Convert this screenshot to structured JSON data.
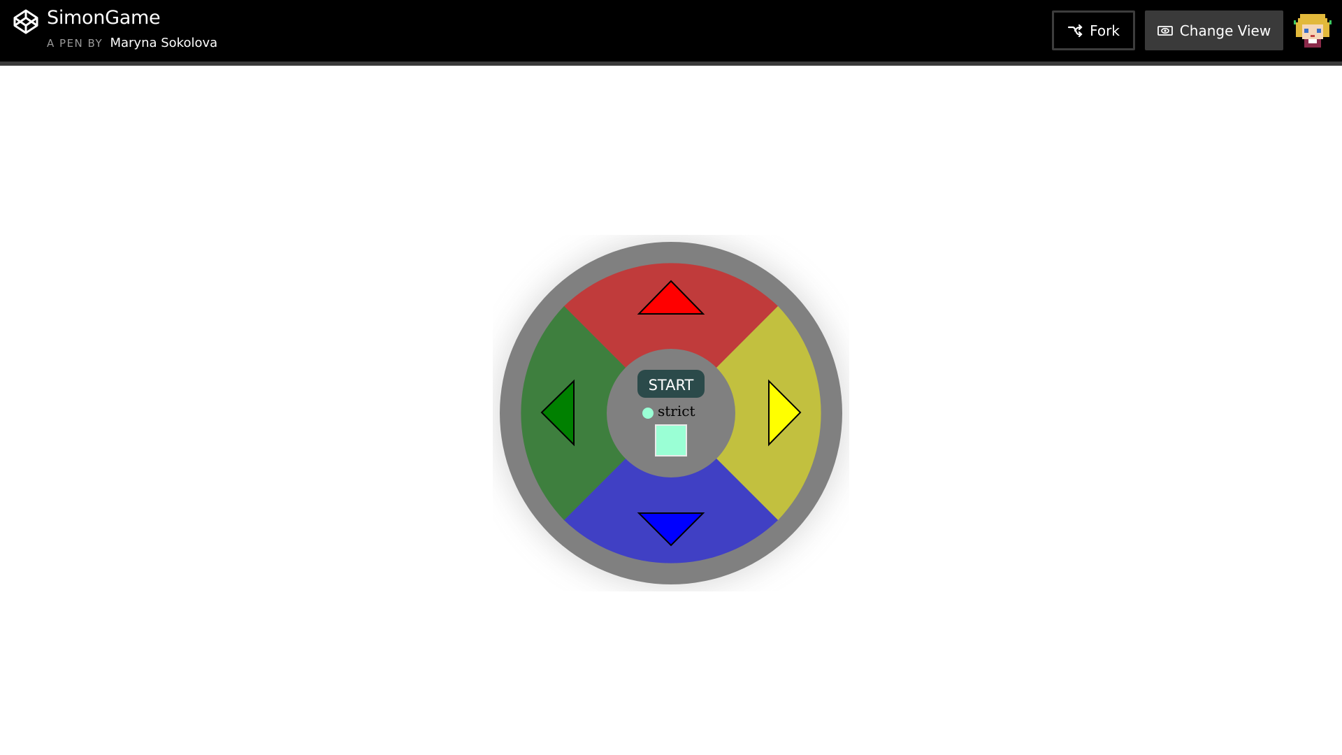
{
  "header": {
    "title": "SimonGame",
    "byline_prefix": "A PEN BY",
    "author": "Maryna Sokolova",
    "fork_label": "Fork",
    "change_view_label": "Change View"
  },
  "game": {
    "start_label": "START",
    "strict_label": "strict",
    "colors": {
      "red_pad": "#c03b3b",
      "green_pad": "#3e7f3e",
      "yellow_pad": "#c2c03f",
      "blue_pad": "#4040c4",
      "bezel": "#808080",
      "start_button": "#2b4a4a",
      "strict_indicator": "#9affd5"
    },
    "icons": [
      "arrow-up-icon",
      "arrow-right-icon",
      "arrow-down-icon",
      "arrow-left-icon"
    ]
  }
}
